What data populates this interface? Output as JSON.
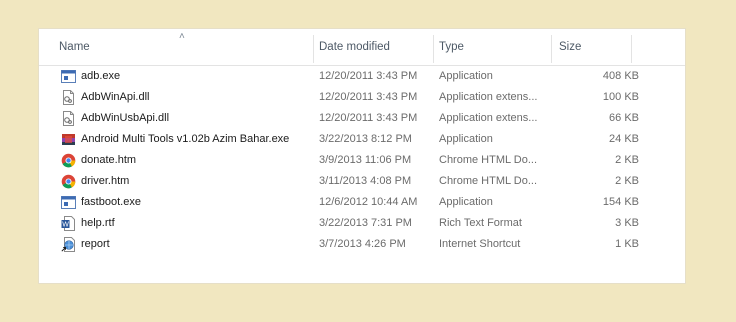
{
  "columns": {
    "name": "Name",
    "date": "Date modified",
    "type": "Type",
    "size": "Size"
  },
  "files": [
    {
      "name": "adb.exe",
      "date": "12/20/2011 3:43 PM",
      "type": "Application",
      "size": "408 KB",
      "icon": "application-icon"
    },
    {
      "name": "AdbWinApi.dll",
      "date": "12/20/2011 3:43 PM",
      "type": "Application extens...",
      "size": "100 KB",
      "icon": "dll-file-icon"
    },
    {
      "name": "AdbWinUsbApi.dll",
      "date": "12/20/2011 3:43 PM",
      "type": "Application extens...",
      "size": "66 KB",
      "icon": "dll-file-icon"
    },
    {
      "name": "Android Multi Tools v1.02b Azim Bahar.exe",
      "date": "3/22/2013 8:12 PM",
      "type": "Application",
      "size": "24 KB",
      "icon": "app-custom-icon"
    },
    {
      "name": "donate.htm",
      "date": "3/9/2013 11:06 PM",
      "type": "Chrome HTML Do...",
      "size": "2 KB",
      "icon": "chrome-icon"
    },
    {
      "name": "driver.htm",
      "date": "3/11/2013 4:08 PM",
      "type": "Chrome HTML Do...",
      "size": "2 KB",
      "icon": "chrome-icon"
    },
    {
      "name": "fastboot.exe",
      "date": "12/6/2012 10:44 AM",
      "type": "Application",
      "size": "154 KB",
      "icon": "application-icon"
    },
    {
      "name": "help.rtf",
      "date": "3/22/2013 7:31 PM",
      "type": "Rich Text Format",
      "size": "3 KB",
      "icon": "word-document-icon"
    },
    {
      "name": "report",
      "date": "3/7/2013 4:26 PM",
      "type": "Internet Shortcut",
      "size": "1 KB",
      "icon": "internet-shortcut-icon"
    }
  ]
}
